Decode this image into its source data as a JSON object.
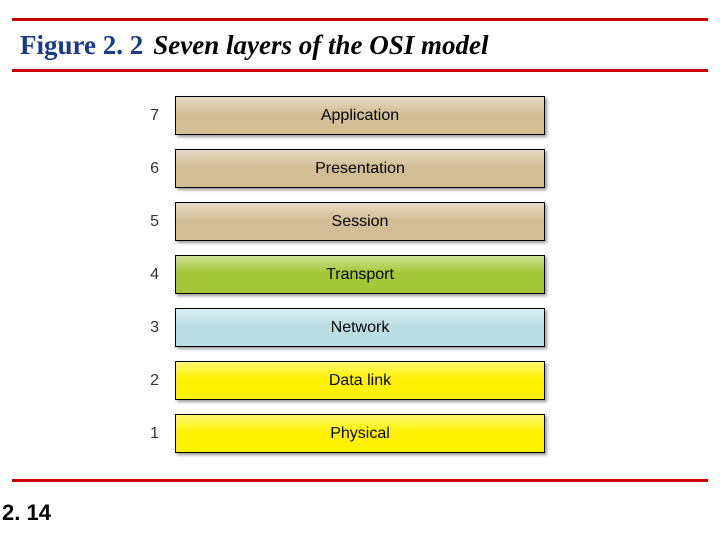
{
  "header": {
    "figure_label": "Figure 2. 2",
    "figure_title": "Seven layers of the OSI model"
  },
  "layers": [
    {
      "number": "7",
      "name": "Application",
      "colorClass": "bg-tan"
    },
    {
      "number": "6",
      "name": "Presentation",
      "colorClass": "bg-tan"
    },
    {
      "number": "5",
      "name": "Session",
      "colorClass": "bg-tan"
    },
    {
      "number": "4",
      "name": "Transport",
      "colorClass": "bg-green"
    },
    {
      "number": "3",
      "name": "Network",
      "colorClass": "bg-blue"
    },
    {
      "number": "2",
      "name": "Data link",
      "colorClass": "bg-yellow"
    },
    {
      "number": "1",
      "name": "Physical",
      "colorClass": "bg-yellow"
    }
  ],
  "footer": {
    "page_number": "2. 14"
  }
}
